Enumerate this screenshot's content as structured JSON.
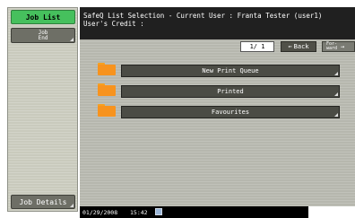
{
  "sidebar": {
    "job_list_label": "Job List",
    "job_end_label_line1": "Job",
    "job_end_label_line2": "End",
    "job_details_label": "Job Details"
  },
  "header": {
    "title": "SafeQ List Selection - Current User : Franta Tester (user1)",
    "credit": "User's Credit :"
  },
  "pager": {
    "page_text": "1/  1",
    "back_label": "Back",
    "forward_label": "For-\nward"
  },
  "queues": [
    {
      "label": "New Print Queue",
      "icon": "folder-icon"
    },
    {
      "label": "Printed",
      "icon": "folder-icon"
    },
    {
      "label": "Favourites",
      "icon": "folder-icon"
    }
  ],
  "footer": {
    "date": "01/29/2008",
    "time": "15:42"
  },
  "colors": {
    "accent_green": "#46c05d",
    "folder_orange": "#f7931e",
    "panel_gray": "#b6b7ae"
  }
}
